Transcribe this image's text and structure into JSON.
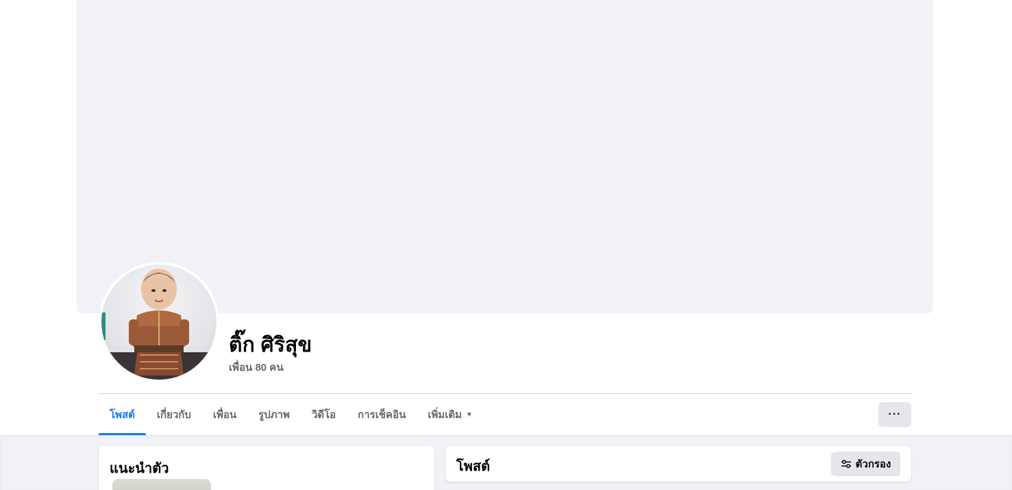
{
  "profile": {
    "name": "ติ๊ก ศิริสุข",
    "friends": "เพื่อน 80 คน"
  },
  "tabs": [
    {
      "label": "โพสต์",
      "active": true
    },
    {
      "label": "เกี่ยวกับ"
    },
    {
      "label": "เพื่อน"
    },
    {
      "label": "รูปภาพ"
    },
    {
      "label": "วิดีโอ"
    },
    {
      "label": "การเช็คอิน"
    },
    {
      "label": "เพิ่มเติม"
    }
  ],
  "more_options": "···",
  "intro": {
    "title": "แนะนำตัว"
  },
  "posts": {
    "title": "โพสต์",
    "filter_label": "ตัวกรอง"
  },
  "colors": {
    "accent": "#1877f2",
    "background": "#f0f2f5",
    "secondary_text": "#65676b"
  }
}
